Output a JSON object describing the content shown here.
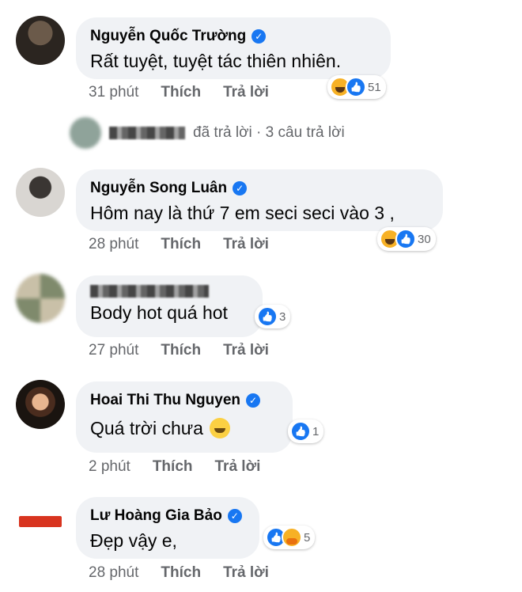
{
  "comments": [
    {
      "name": "Nguyễn Quốc Trường",
      "text": "Rất tuyệt, tuyệt tác thiên nhiên.",
      "time": "31 phút",
      "like_label": "Thích",
      "reply_label": "Trả lời",
      "reaction_count": "51",
      "reactions": [
        "haha-icon",
        "like-icon"
      ]
    },
    {
      "name": "Nguyễn Song Luân",
      "text": "Hôm nay là thứ 7 em seci seci vào 3 ,",
      "time": "28 phút",
      "like_label": "Thích",
      "reply_label": "Trả lời",
      "reaction_count": "30",
      "reactions": [
        "haha-icon",
        "like-icon"
      ]
    },
    {
      "name": "",
      "text": "Body hot quá hot",
      "time": "27 phút",
      "like_label": "Thích",
      "reply_label": "Trả lời",
      "reaction_count": "3",
      "reactions": [
        "like-icon"
      ]
    },
    {
      "name": "Hoai Thi Thu Nguyen",
      "text": "Quá trời chưa",
      "time": "2 phút",
      "like_label": "Thích",
      "reply_label": "Trả lời",
      "reaction_count": "1",
      "reactions": [
        "like-icon"
      ]
    },
    {
      "name": "Lư Hoàng Gia Bảo",
      "text": "Đẹp vậy e,",
      "time": "28 phút",
      "like_label": "Thích",
      "reply_label": "Trả lời",
      "reaction_count": "5",
      "reactions": [
        "like-icon",
        "care-icon"
      ]
    }
  ],
  "reply_summary": {
    "text": "đã trả lời · 3 câu trả lời"
  },
  "colors": {
    "bubble": "#f0f2f5",
    "meta_text": "#65676b",
    "verified": "#1877f2"
  }
}
